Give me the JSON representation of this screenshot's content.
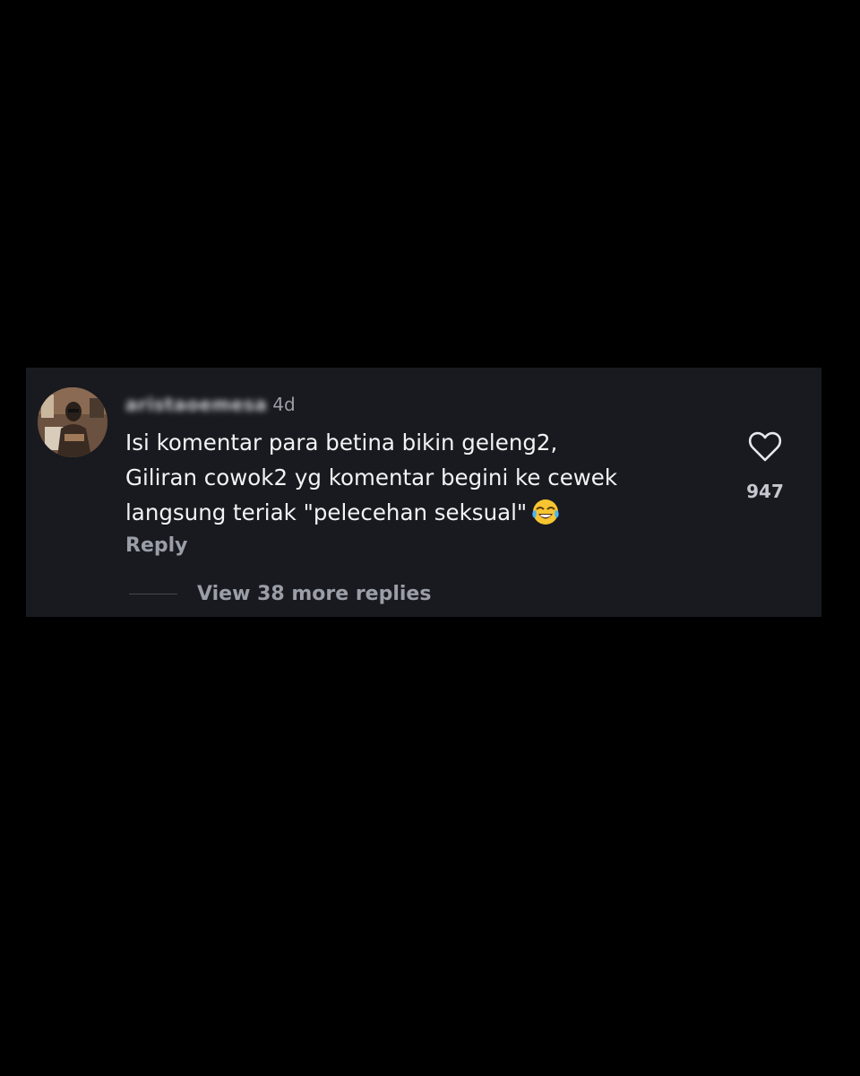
{
  "comment": {
    "username": "aristaoemesa",
    "time_ago": "4d",
    "lines": [
      "Isi komentar para betina bikin geleng2,",
      "Giliran cowok2 yg komentar begini ke cewek",
      "langsung teriak \"pelecehan seksual\""
    ],
    "emoji": "face-with-tears-of-joy",
    "reply_label": "Reply",
    "like_count": "947",
    "view_replies_label": "View 38 more replies"
  },
  "colors": {
    "page_background": "#000000",
    "card_background": "#191a1f",
    "primary_text": "#f2f3f5",
    "secondary_text": "#9a9ea7"
  }
}
